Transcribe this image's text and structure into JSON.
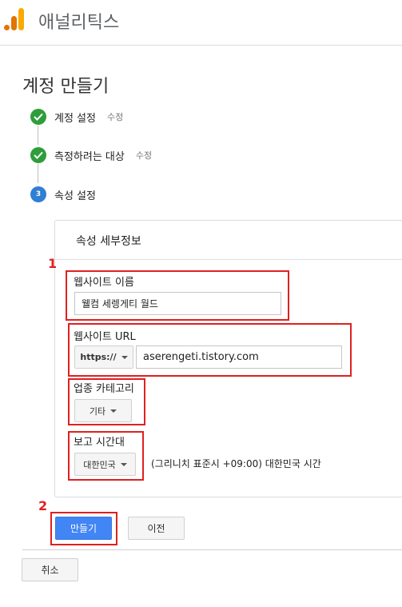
{
  "header": {
    "app_name": "애널리틱스"
  },
  "page": {
    "title": "계정 만들기"
  },
  "steps": [
    {
      "label": "계정 설정",
      "edit": "수정",
      "status": "done"
    },
    {
      "label": "측정하려는 대상",
      "edit": "수정",
      "status": "done"
    },
    {
      "label": "속성 설정",
      "number": "3",
      "status": "current"
    }
  ],
  "property": {
    "title": "속성 세부정보",
    "website_name": {
      "label": "웹사이트 이름",
      "value": "웰컴 세렝게티 월드"
    },
    "website_url": {
      "label": "웹사이트 URL",
      "protocol": "https://",
      "value": "aserengeti.tistory.com"
    },
    "category": {
      "label": "업종 카테고리",
      "value": "기타"
    },
    "timezone": {
      "label": "보고 시간대",
      "country": "대한민국",
      "zone_text": "(그리니치 표준시 +09:00) 대한민국 시간"
    }
  },
  "actions": {
    "create": "만들기",
    "previous": "이전",
    "cancel": "취소"
  },
  "annotations": {
    "badge1": "1",
    "badge2": "2"
  },
  "colors": {
    "check_green": "#2e9d3b",
    "step_blue": "#2f7fd3",
    "primary_blue": "#4285f4",
    "annotation_red": "#e02020"
  }
}
